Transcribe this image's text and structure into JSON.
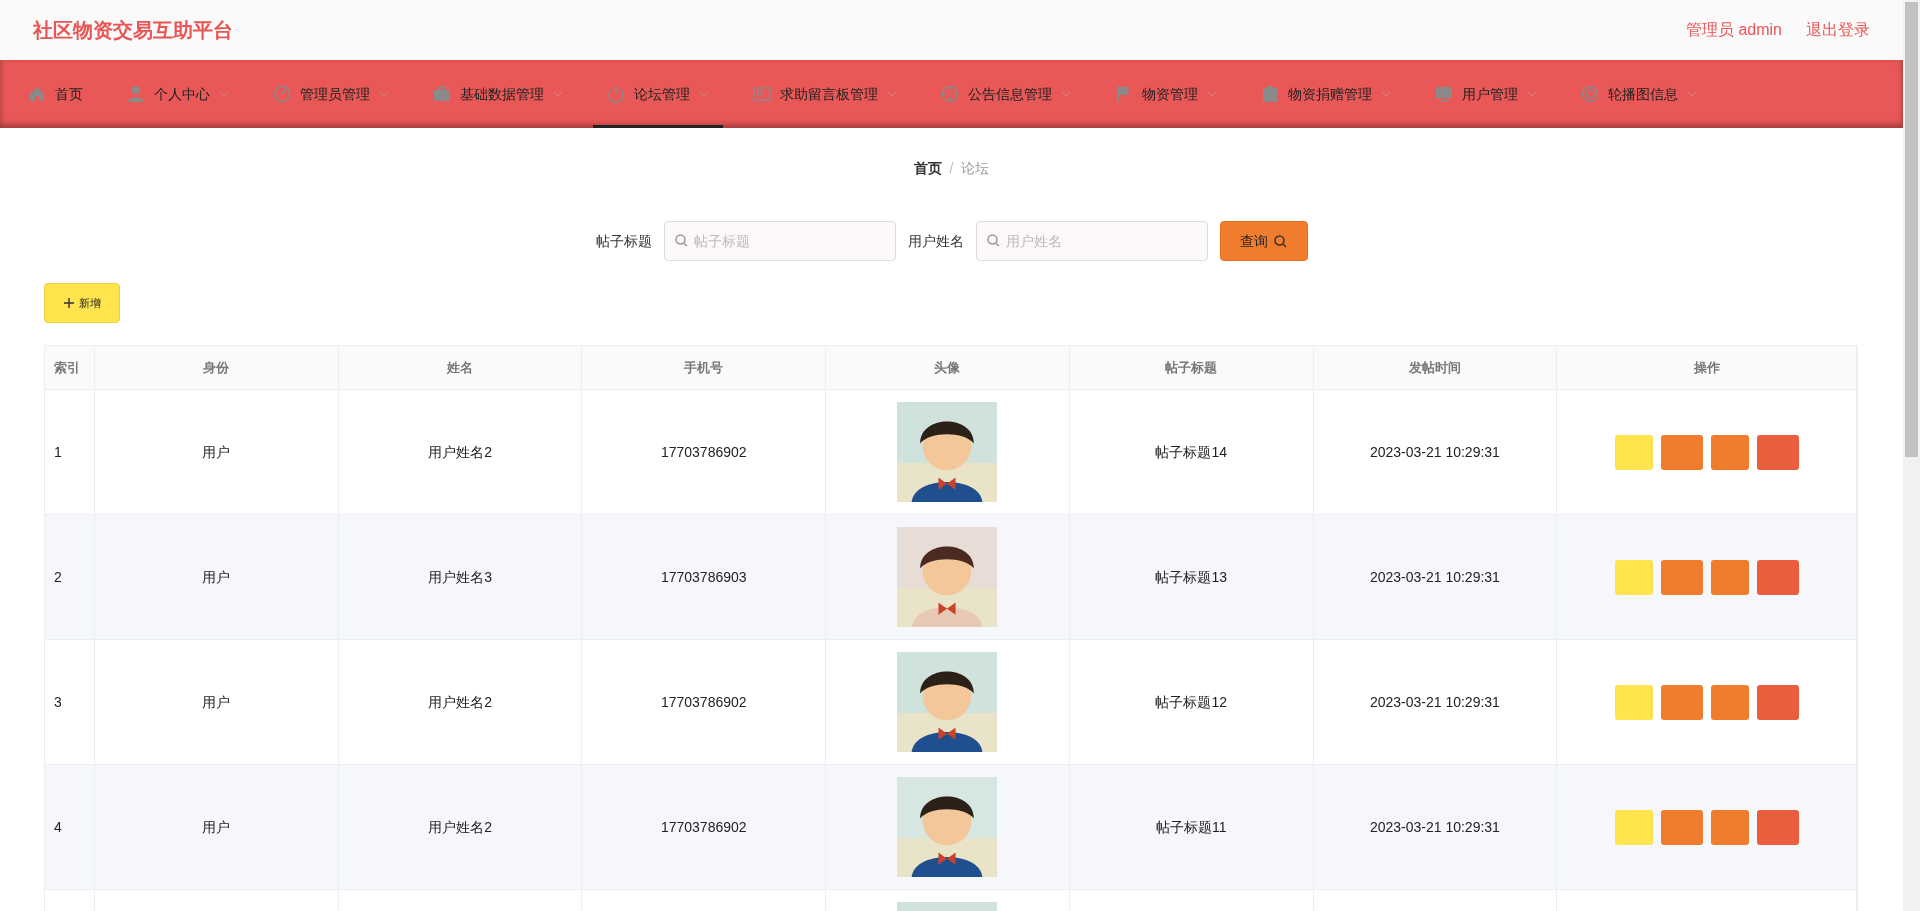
{
  "header": {
    "title": "社区物资交易互助平台",
    "user": "管理员 admin",
    "logout": "退出登录"
  },
  "nav": [
    {
      "label": "首页",
      "dropdown": false,
      "selected": false
    },
    {
      "label": "个人中心",
      "dropdown": true,
      "selected": false
    },
    {
      "label": "管理员管理",
      "dropdown": true,
      "selected": false
    },
    {
      "label": "基础数据管理",
      "dropdown": true,
      "selected": false
    },
    {
      "label": "论坛管理",
      "dropdown": true,
      "selected": true
    },
    {
      "label": "求助留言板管理",
      "dropdown": true,
      "selected": false
    },
    {
      "label": "公告信息管理",
      "dropdown": true,
      "selected": false
    },
    {
      "label": "物资管理",
      "dropdown": true,
      "selected": false
    },
    {
      "label": "物资捐赠管理",
      "dropdown": true,
      "selected": false
    },
    {
      "label": "用户管理",
      "dropdown": true,
      "selected": false
    },
    {
      "label": "轮播图信息",
      "dropdown": true,
      "selected": false
    }
  ],
  "breadcrumb": {
    "items": [
      "首页",
      "论坛"
    ],
    "separator": "/"
  },
  "search": {
    "fields": [
      {
        "label": "帖子标题",
        "placeholder": "帖子标题"
      },
      {
        "label": "用户姓名",
        "placeholder": "用户姓名"
      }
    ],
    "button": "查询"
  },
  "add_button": "新增",
  "table": {
    "columns": [
      "索引",
      "身份",
      "姓名",
      "手机号",
      "头像",
      "帖子标题",
      "发帖时间",
      "操作"
    ],
    "actions": [
      {
        "color": "#ffe44d"
      },
      {
        "color": "#f07c2e"
      },
      {
        "color": "#f07c2e"
      },
      {
        "color": "#e95f3e"
      }
    ],
    "rows": [
      {
        "kind": "full",
        "index": "1",
        "role": "用户",
        "name": "用户姓名2",
        "phone": "17703786902",
        "title": "帖子标题14",
        "time": "2023-03-21 10:29:31"
      },
      {
        "kind": "full",
        "index": "2",
        "role": "用户",
        "name": "用户姓名3",
        "phone": "17703786903",
        "title": "帖子标题13",
        "time": "2023-03-21 10:29:31"
      },
      {
        "kind": "full",
        "index": "3",
        "role": "用户",
        "name": "用户姓名2",
        "phone": "17703786902",
        "title": "帖子标题12",
        "time": "2023-03-21 10:29:31"
      },
      {
        "kind": "full",
        "index": "4",
        "role": "用户",
        "name": "用户姓名2",
        "phone": "17703786902",
        "title": "帖子标题11",
        "time": "2023-03-21 10:29:31"
      },
      {
        "kind": "partial"
      }
    ]
  }
}
